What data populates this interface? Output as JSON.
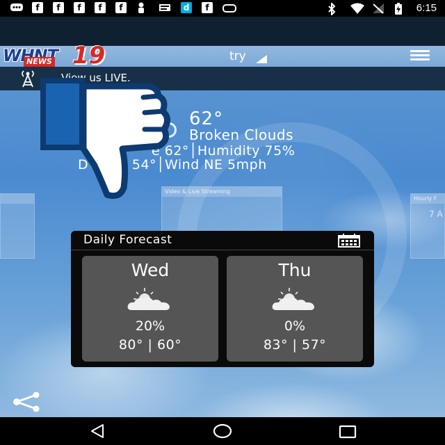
{
  "status_bar": {
    "time": "6:15",
    "left_icons": [
      "chat-icon",
      "facebook-icon",
      "facebook-icon",
      "facebook-icon",
      "facebook-icon",
      "facebook-icon",
      "person-icon",
      "news-icon",
      "dash-icon",
      "facebook-icon",
      "alert-icon"
    ],
    "right_icons": [
      "bluetooth-icon",
      "wifi-icon",
      "signal-icon",
      "battery-charging-icon"
    ]
  },
  "header": {
    "logo_text": "WHNT",
    "logo_number": "19",
    "logo_sub": "NEWS",
    "location_label": "try",
    "menu_icon": "hamburger-icon"
  },
  "live": {
    "text": "View us LIVE.",
    "icon": "broadcast-tower-icon"
  },
  "current": {
    "temp": "62°",
    "condition": "Broken Clouds",
    "line1": "e  62°│Humidity  75%",
    "line2": "D    Point  54°│Wind  NE 5mph"
  },
  "ghost_cards": {
    "center_title": "Video & Live Streaming",
    "right_title": "Hourly F",
    "right_value": "7 A"
  },
  "forecast": {
    "title": "Daily Forecast",
    "calendar_icon": "calendar-icon",
    "days": [
      {
        "day": "Wed",
        "precip": "20%",
        "temps": "80°  |  60°",
        "icon": "partly-cloudy-icon"
      },
      {
        "day": "Thu",
        "precip": "0%",
        "temps": "83°  |  57°",
        "icon": "partly-cloudy-icon"
      }
    ]
  },
  "overlay": {
    "icon": "thumbs-down-icon",
    "color": "#1a63b0"
  },
  "nav": {
    "back_icon": "back-triangle-icon",
    "home_icon": "home-circle-icon",
    "recent_icon": "recent-apps-icon"
  }
}
